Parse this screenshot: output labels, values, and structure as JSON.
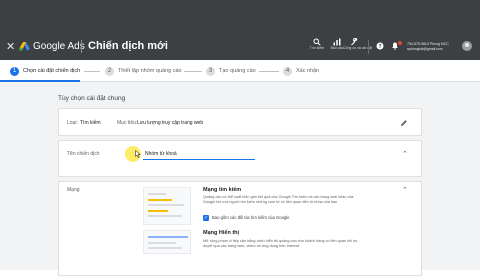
{
  "header": {
    "brand": "Google Ads",
    "title": "Chiến dịch mới",
    "tools": [
      {
        "icon": "search-icon",
        "label": "Tìm kiếm"
      },
      {
        "icon": "report-icon",
        "label": "Báo cáo"
      },
      {
        "icon": "tools-icon",
        "label": "Công cụ và cài đặt"
      }
    ],
    "account_name": "794-575-9613 Phong MCC",
    "account_email": "nphongtuk@gmail.com"
  },
  "steps": [
    {
      "num": "1",
      "label": "Chọn cài đặt chiến dịch",
      "active": true
    },
    {
      "num": "2",
      "label": "Thiết lập nhóm quảng cáo",
      "active": false
    },
    {
      "num": "3",
      "label": "Tạo quảng cáo",
      "active": false
    },
    {
      "num": "4",
      "label": "Xác nhận",
      "active": false
    }
  ],
  "main": {
    "section_title": "Tùy chọn cài đặt chung",
    "type_card": {
      "type_label": "Loại:",
      "type_value": "Tìm kiếm",
      "goal_label": "Mục tiêu:",
      "goal_value": "Lưu lượng truy cập trang web"
    },
    "name_card": {
      "label": "Tên chiến dịch",
      "value": "Nhóm từ khoá"
    },
    "network_card": {
      "label": "Mạng",
      "search_title": "Mạng tìm kiếm",
      "search_desc": "Quảng cáo có thể xuất hiện gần kết quả của Google Tìm kiếm và các trang web khác của Google khi mọi người tìm kiếm những cụm từ có liên quan đến từ khóa của bạn",
      "search_checkbox": "Bao gồm các đối tác tìm kiếm của Google",
      "display_title": "Mạng Hiển thị",
      "display_desc": "Mở rộng phạm vi tiếp cận bằng cách hiển thị quảng cáo cho khách hàng có liên quan khi họ duyệt qua các trang web, video và ứng dụng trên Internet"
    }
  },
  "colors": {
    "topbar": "#3c4043",
    "accent": "#1a73e8",
    "highlight": "#fbe94b"
  }
}
